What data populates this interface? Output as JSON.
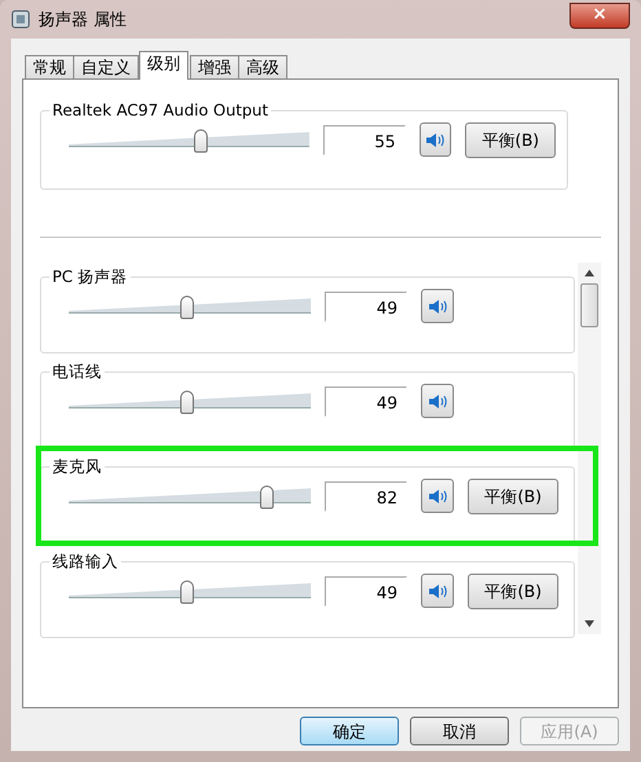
{
  "window": {
    "title": "扬声器 属性",
    "close": "×"
  },
  "tabs": [
    {
      "label": "常规",
      "selected": false
    },
    {
      "label": "自定义",
      "selected": false
    },
    {
      "label": "级别",
      "selected": true
    },
    {
      "label": "增强",
      "selected": false
    },
    {
      "label": "高级",
      "selected": false
    }
  ],
  "master": {
    "name": "Realtek AC97 Audio Output",
    "level": 0.55,
    "reading": "55",
    "balance": "平衡(B)"
  },
  "channels": [
    {
      "name": "PC 扬声器",
      "level": 0.49,
      "reading": "49",
      "highlighted": false
    },
    {
      "name": "电话线",
      "level": 0.49,
      "reading": "49",
      "highlighted": false
    },
    {
      "name": "麦克风",
      "level": 0.82,
      "reading": "82",
      "balance": "平衡(B)",
      "highlighted": true
    },
    {
      "name": "线路输入",
      "level": 0.49,
      "reading": "49",
      "balance": "平衡(B)",
      "highlighted": false
    }
  ],
  "buttons": [
    {
      "label": "确定",
      "kind": "default",
      "disabled": false
    },
    {
      "label": "取消",
      "kind": "normal",
      "disabled": false
    },
    {
      "label": "应用(A)",
      "kind": "normal",
      "disabled": true
    }
  ]
}
